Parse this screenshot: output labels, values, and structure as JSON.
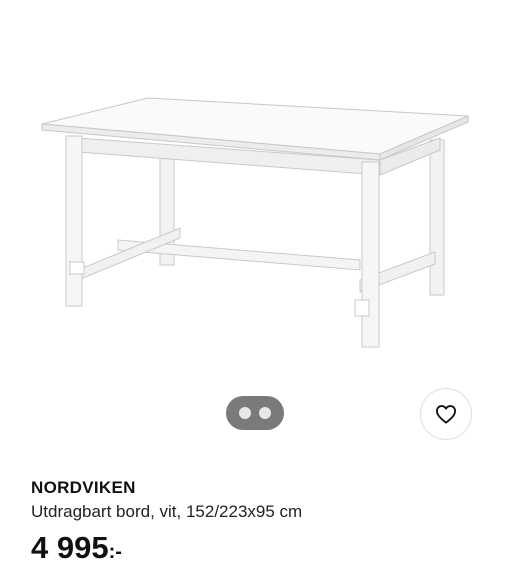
{
  "product": {
    "name": "NORDVIKEN",
    "description": "Utdragbart bord, vit, 152/223x95 cm",
    "price": "4 995",
    "price_suffix": ":-",
    "image": {
      "subject": "white extendable dining table",
      "icon": "table-product-image"
    }
  },
  "carousel": {
    "dots": 2,
    "active_index": 0,
    "color": "#7a7a7a"
  },
  "favorite": {
    "icon": "heart-outline-icon"
  }
}
